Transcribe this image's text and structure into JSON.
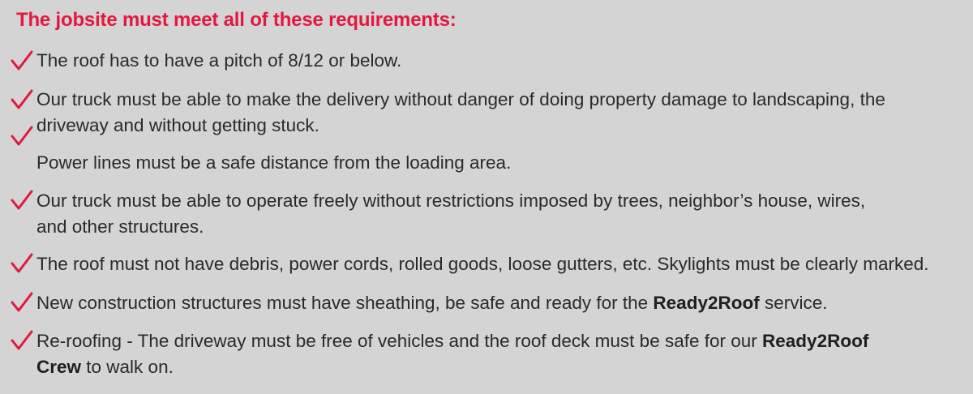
{
  "heading": "The jobsite must meet all of these requirements:",
  "colors": {
    "accent": "#e4173e",
    "background": "#d4d4d5",
    "text": "#2a2a2a"
  },
  "icon": "checkmark-icon",
  "lines": {
    "l1": "The roof has to have a pitch of 8/12 or below.",
    "l2": "Our truck must be able to make the delivery without danger of doing property damage to landscaping, the",
    "l3": "driveway and without getting stuck.",
    "l4": "Power lines must be a safe distance from the loading area.",
    "l5": "Our truck must be able to operate freely without restrictions imposed by trees, neighbor’s house, wires,",
    "l6": "and other structures.",
    "l7": "The roof must not have debris, power cords, rolled goods, loose gutters, etc. Skylights must be clearly marked.",
    "l8a": "New construction structures must have sheathing, be safe and ready for the ",
    "l8b": "Ready2Roof",
    "l8c": " service.",
    "l9a": "Re-roofing - The driveway must be free of vehicles and the roof deck must be safe for our ",
    "l9b": "Ready2Roof",
    "l10a": "Crew",
    "l10b": " to walk on."
  }
}
